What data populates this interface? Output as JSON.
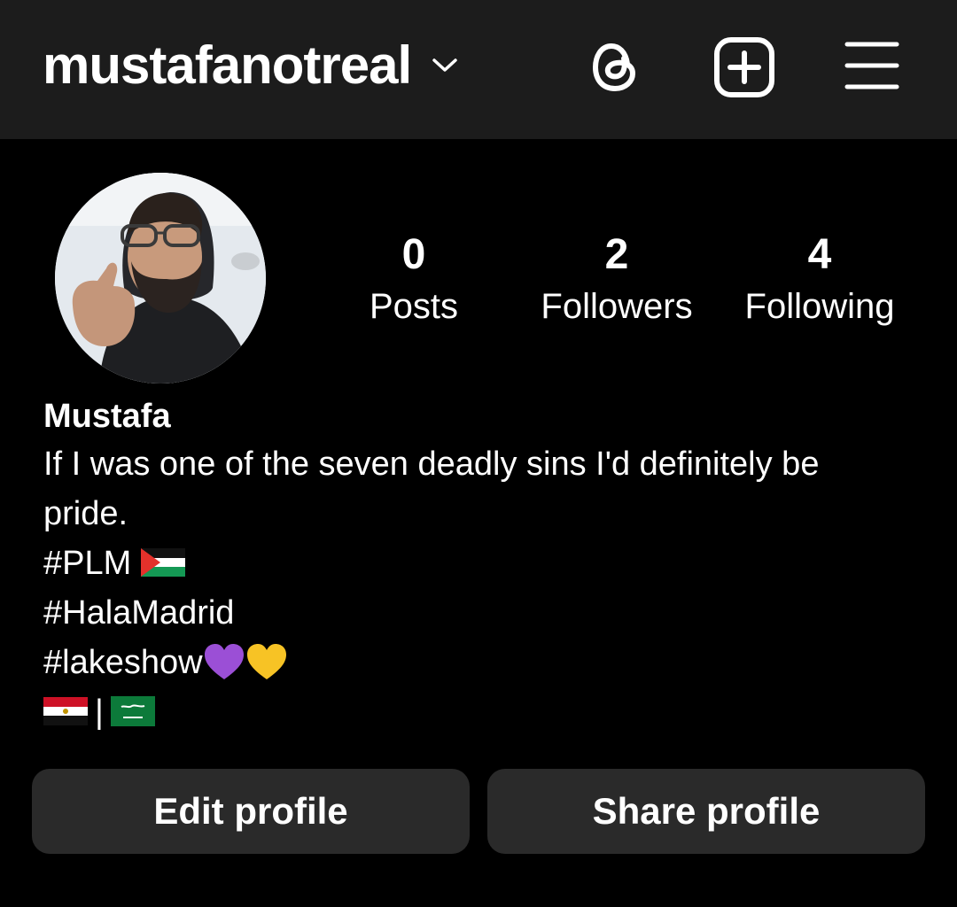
{
  "header": {
    "username": "mustafanotreal",
    "icons": [
      "chevron-down-icon",
      "threads-icon",
      "new-post-icon",
      "hamburger-menu-icon"
    ]
  },
  "stats": {
    "posts": {
      "count": "0",
      "label": "Posts"
    },
    "followers": {
      "count": "2",
      "label": "Followers"
    },
    "following": {
      "count": "4",
      "label": "Following"
    }
  },
  "profile": {
    "display_name": "Mustafa",
    "bio_line1": "If I was one of the seven deadly sins I'd definitely be",
    "bio_line2": "pride.",
    "tag_plm": "#PLM",
    "tag_hala": "#HalaMadrid",
    "tag_lakeshow": "#lakeshow",
    "separator": "|"
  },
  "buttons": {
    "edit": "Edit profile",
    "share": "Share profile"
  },
  "colors": {
    "background": "#000000",
    "topbar": "#1c1c1c",
    "button": "#2a2a2a",
    "text": "#ffffff"
  }
}
